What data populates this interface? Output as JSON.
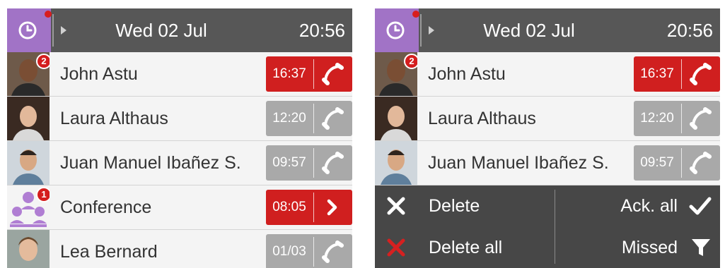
{
  "colors": {
    "header_bg": "#575757",
    "history_button": "#a173c6",
    "missed_red": "#d01f1f",
    "answered_grey": "#a9a9a9",
    "action_panel_bg": "#474747"
  },
  "screens": [
    {
      "header": {
        "history_icon": "clock-icon",
        "expand_icon": "chevron-right-icon",
        "date": "Wed 02 Jul",
        "time": "20:56"
      },
      "calls": [
        {
          "name": "John Astu",
          "time": "16:37",
          "badge": "2",
          "status": "missed",
          "action_icon": "phone-handset-icon"
        },
        {
          "name": "Laura Althaus",
          "time": "12:20",
          "badge": "",
          "status": "answered",
          "action_icon": "phone-handset-icon"
        },
        {
          "name": "Juan Manuel Ibañez S.",
          "time": "09:57",
          "badge": "",
          "status": "answered",
          "action_icon": "phone-handset-icon"
        },
        {
          "name": "Conference",
          "time": "08:05",
          "badge": "1",
          "status": "missed",
          "action_icon": "chevron-right-icon"
        },
        {
          "name": "Lea Bernard",
          "time": "01/03",
          "badge": "",
          "status": "answered",
          "action_icon": "phone-handset-icon"
        }
      ]
    },
    {
      "header": {
        "history_icon": "clock-icon",
        "expand_icon": "chevron-right-icon",
        "date": "Wed 02 Jul",
        "time": "20:56"
      },
      "calls": [
        {
          "name": "John Astu",
          "time": "16:37",
          "badge": "2",
          "status": "missed",
          "action_icon": "phone-handset-icon"
        },
        {
          "name": "Laura Althaus",
          "time": "12:20",
          "badge": "",
          "status": "answered",
          "action_icon": "phone-handset-icon"
        },
        {
          "name": "Juan Manuel Ibañez S.",
          "time": "09:57",
          "badge": "",
          "status": "answered",
          "action_icon": "phone-handset-icon"
        }
      ],
      "actions": {
        "delete": {
          "label": "Delete",
          "icon": "close-icon"
        },
        "delete_all": {
          "label": "Delete all",
          "icon": "close-red-icon"
        },
        "ack_all": {
          "label": "Ack. all",
          "icon": "checkmark-icon"
        },
        "missed": {
          "label": "Missed",
          "icon": "filter-icon"
        }
      }
    }
  ]
}
